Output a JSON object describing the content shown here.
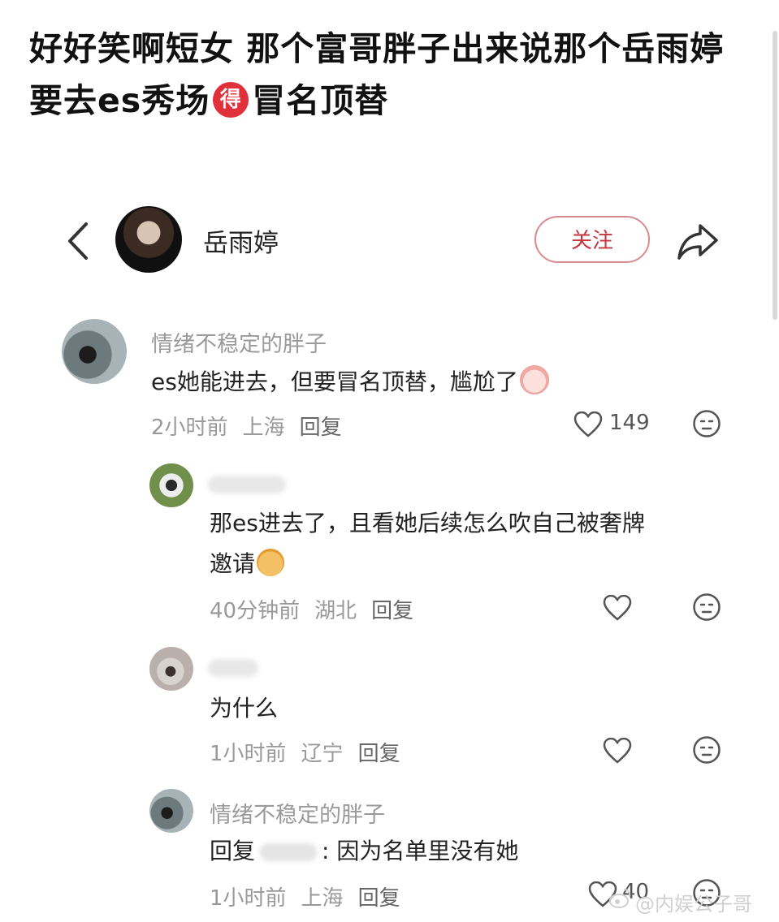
{
  "post": {
    "title_part1": "好好笑啊短女 那个富哥胖子出来说那个岳雨婷要去es秀场",
    "badge": "得",
    "title_part2": "冒名顶替"
  },
  "profile": {
    "name": "岳雨婷",
    "follow_label": "关注"
  },
  "comments": [
    {
      "username": "情绪不稳定的胖子",
      "text": "es她能进去，但要冒名顶替，尴尬了",
      "time": "2小时前",
      "location": "上海",
      "reply_label": "回复",
      "likes": "149"
    },
    {
      "username": "",
      "text_line1": "那es进去了，且看她后续怎么吹自己被奢牌",
      "text_line2": "邀请",
      "time": "40分钟前",
      "location": "湖北",
      "reply_label": "回复",
      "likes": ""
    },
    {
      "username": "",
      "text": "为什么",
      "time": "1小时前",
      "location": "辽宁",
      "reply_label": "回复",
      "likes": ""
    },
    {
      "username": "情绪不稳定的胖子",
      "reply_prefix": "回复",
      "text": ": 因为名单里没有她",
      "time": "1小时前",
      "location": "上海",
      "reply_label": "回复",
      "likes": "40"
    }
  ],
  "watermark": "@内娱公子哥",
  "icons": [
    "back-icon",
    "share-icon",
    "heart-icon",
    "face-icon",
    "peach-emoji",
    "dog-emoji",
    "weibo-icon"
  ],
  "colors": {
    "follow": "#c8343e",
    "badge": "#e0303a"
  }
}
